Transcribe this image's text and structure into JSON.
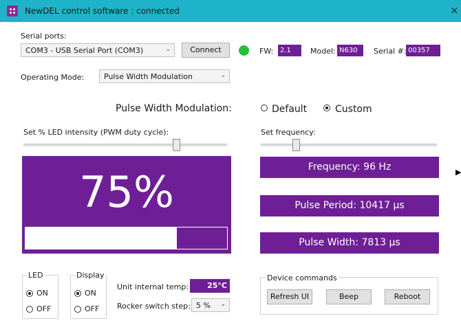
{
  "window": {
    "title": "NewDEL control software : connected",
    "close_glyph": "×"
  },
  "serial": {
    "label": "Serial ports:",
    "selected_port": "COM3 - USB Serial Port (COM3)",
    "connect_label": "Connect",
    "status_color": "#22c036"
  },
  "device": {
    "fw_label": "FW:",
    "fw_value": "2.1",
    "model_label": "Model:",
    "model_value": "N630",
    "serial_label": "Serial #:",
    "serial_value": "00357"
  },
  "mode": {
    "label": "Operating Mode:",
    "selected": "Pulse Width Modulation"
  },
  "pwm": {
    "heading": "Pulse Width Modulation:",
    "option_default": "Default",
    "option_custom": "Custom",
    "selected_option": "custom",
    "intensity_label": "Set % LED intensity (PWM duty cycle):",
    "intensity_slider_fraction": 0.75,
    "frequency_label": "Set frequency:",
    "frequency_slider_fraction": 0.2,
    "intensity_display": "75%",
    "intensity_progress_fraction": 0.75,
    "frequency_text": "Frequency: 96 Hz",
    "period_text": "Pulse Period: 10417 µs",
    "width_text": "Pulse Width: 7813 µs"
  },
  "led_group": {
    "title": "LED",
    "on_label": "ON",
    "off_label": "OFF",
    "selected": "on"
  },
  "display_group": {
    "title": "Display",
    "on_label": "ON",
    "off_label": "OFF",
    "selected": "on"
  },
  "temp": {
    "label": "Unit internal temp:",
    "value": "25°C"
  },
  "rocker": {
    "label": "Rocker switch step:",
    "value": "5 %"
  },
  "commands": {
    "title": "Device commands",
    "refresh_label": "Refresh UI",
    "beep_label": "Beep",
    "reboot_label": "Reboot"
  },
  "colors": {
    "accent": "#6f1f96",
    "titlebar": "#1fb3c9"
  },
  "icons": {
    "app": "app-logo-icon",
    "close": "close-icon",
    "dropdown": "chevron-down-icon",
    "side": "play-arrow-icon"
  }
}
